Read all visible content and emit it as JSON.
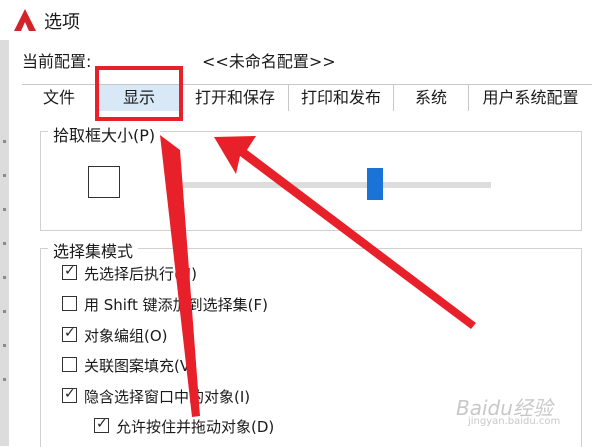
{
  "window": {
    "title": "选项"
  },
  "profile": {
    "label": "当前配置:",
    "value": "<<未命名配置>>"
  },
  "tabs": [
    {
      "label": "文件"
    },
    {
      "label": "显示"
    },
    {
      "label": "打开和保存"
    },
    {
      "label": "打印和发布"
    },
    {
      "label": "系统"
    },
    {
      "label": "用户系统配置"
    }
  ],
  "pickbox": {
    "title": "拾取框大小(P)",
    "slider_level": 0.65
  },
  "selection_modes": {
    "title": "选择集模式",
    "options": [
      {
        "label": "先选择后执行(N)",
        "checked": true
      },
      {
        "label": "用 Shift 键添加到选择集(F)",
        "checked": false
      },
      {
        "label": "对象编组(O)",
        "checked": true
      },
      {
        "label": "关联图案填充(V)",
        "checked": false
      },
      {
        "label": "隐含选择窗口中的对象(I)",
        "checked": true
      },
      {
        "label": "允许按住并拖动对象(D)",
        "checked": true
      }
    ]
  },
  "watermark": {
    "main": "Baidu经验",
    "sub": "jingyan.baidu.com"
  },
  "colors": {
    "accent": "#1a73d6",
    "annotation": "#e8202a",
    "tab_active": "#d9e8f7"
  }
}
